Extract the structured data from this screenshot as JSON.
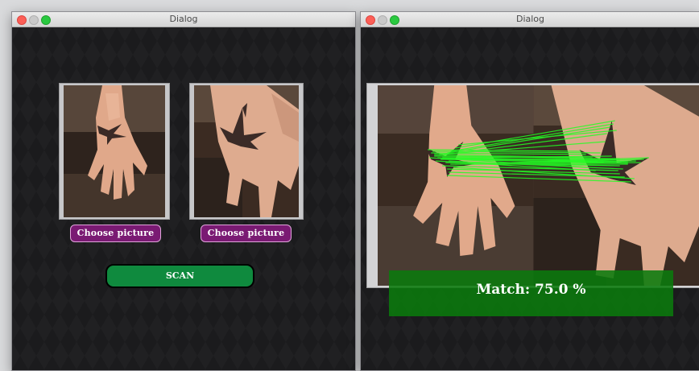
{
  "windows": {
    "left": {
      "title": "Dialog",
      "choose_left_label": "Choose picture",
      "choose_right_label": "Choose picture",
      "scan_label": "SCAN"
    },
    "right": {
      "title": "Dialog",
      "match_text": "Match: 75.0 %"
    }
  },
  "colors": {
    "window_bg": "#1b1b1d",
    "choose_button": "#7a1a73",
    "scan_button": "#0f8a3e",
    "match_banner": "#0a7a0c",
    "match_lines": "#22ff22"
  },
  "icons": [
    "close-icon",
    "minimize-icon",
    "maximize-icon"
  ]
}
